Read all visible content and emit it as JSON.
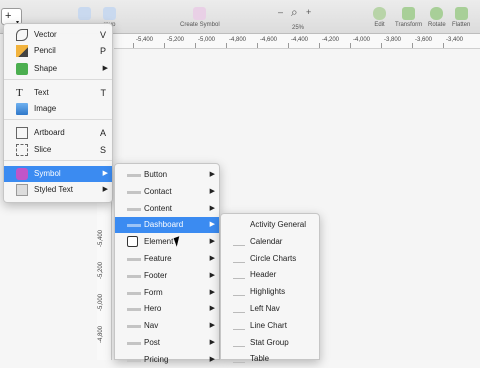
{
  "toolbar": {
    "group_label": "roup",
    "create_symbol_label": "Create Symbol",
    "zoom_level": "25%",
    "zoom_minus": "–",
    "zoom_plus": "+",
    "edit_label": "Edit",
    "transform_label": "Transform",
    "rotate_label": "Rotate",
    "flatten_label": "Flatten",
    "insert_glyph": "+",
    "insert_chevron": "▾"
  },
  "ruler_h": [
    "-5,400",
    "-5,200",
    "-5,000",
    "-4,800",
    "-4,600",
    "-4,400",
    "-4,200",
    "-4,000",
    "-3,800",
    "-3,600",
    "-3,400"
  ],
  "ruler_v": [
    "-5,400",
    "-5,200",
    "-5,000",
    "-4,800"
  ],
  "insert_menu": [
    {
      "label": "Vector",
      "key": "V",
      "icon": "vector-icon"
    },
    {
      "label": "Pencil",
      "key": "P",
      "icon": "pencil-icon"
    },
    {
      "label": "Shape",
      "arrow": "▶",
      "icon": "shape-icon"
    },
    {
      "label": "Text",
      "key": "T",
      "icon": "text-icon"
    },
    {
      "label": "Image",
      "icon": "image-icon"
    },
    {
      "label": "Artboard",
      "key": "A",
      "icon": "artboard-icon"
    },
    {
      "label": "Slice",
      "key": "S",
      "icon": "slice-icon"
    },
    {
      "label": "Symbol",
      "arrow": "▶",
      "icon": "symbol-icon"
    },
    {
      "label": "Styled Text",
      "arrow": "▶",
      "icon": "styled-text-icon"
    }
  ],
  "symbol_menu": [
    "Button",
    "Contact",
    "Content",
    "Dashboard",
    "Element",
    "Feature",
    "Footer",
    "Form",
    "Hero",
    "Nav",
    "Post",
    "Pricing"
  ],
  "dashboard_menu": [
    "Activity General",
    "Calendar",
    "Circle Charts",
    "Header",
    "Highlights",
    "Left Nav",
    "Line Chart",
    "Stat Group",
    "Table"
  ],
  "submenu_arrow": "▶",
  "colors": {
    "highlight": "#3b8bf1"
  }
}
